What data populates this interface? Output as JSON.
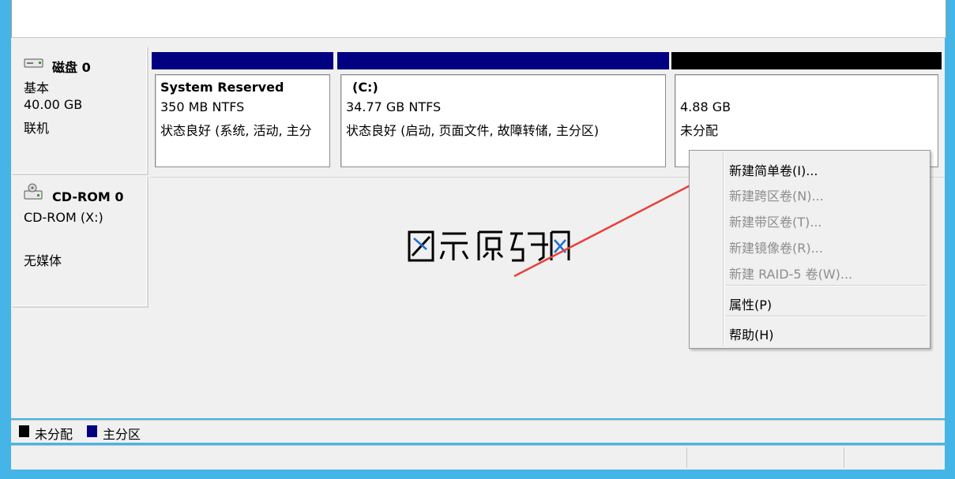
{
  "disk0": {
    "title": "磁盘 0",
    "type": "基本",
    "size": "40.00 GB",
    "status": "联机",
    "icon": "hard-disk-icon"
  },
  "partitions": [
    {
      "name": "System Reserved",
      "size": "350 MB NTFS",
      "status": "状态良好 (系统, 活动, 主分",
      "header_color": "#000080"
    },
    {
      "name": "(C:)",
      "size": "34.77 GB NTFS",
      "status": "状态良好 (启动, 页面文件, 故障转储, 主分区)",
      "header_color": "#000080"
    },
    {
      "size": "4.88 GB",
      "status": "未分配",
      "header_color": "#000000"
    }
  ],
  "cdrom": {
    "title": "CD-ROM 0",
    "type": "CD-ROM (X:)",
    "status": "无媒体",
    "icon": "cdrom-drive-icon"
  },
  "context_menu": {
    "items": [
      {
        "label": "新建简单卷(I)...",
        "enabled": true
      },
      {
        "label": "新建跨区卷(N)...",
        "enabled": false
      },
      {
        "label": "新建带区卷(T)...",
        "enabled": false
      },
      {
        "label": "新建镜像卷(R)...",
        "enabled": false
      },
      {
        "label": "新建 RAID-5 卷(W)...",
        "enabled": false
      },
      {
        "label": "属性(P)",
        "enabled": true
      },
      {
        "label": "帮助(H)",
        "enabled": true
      }
    ]
  },
  "legend": [
    {
      "label": "未分配",
      "color": "#000000"
    },
    {
      "label": "主分区",
      "color": "#000080"
    }
  ],
  "watermark": "图示源码网",
  "colors": {
    "frame": "#45b4e6",
    "primary": "#000080",
    "unallocated": "#000000",
    "arrow": "#e8413a"
  }
}
